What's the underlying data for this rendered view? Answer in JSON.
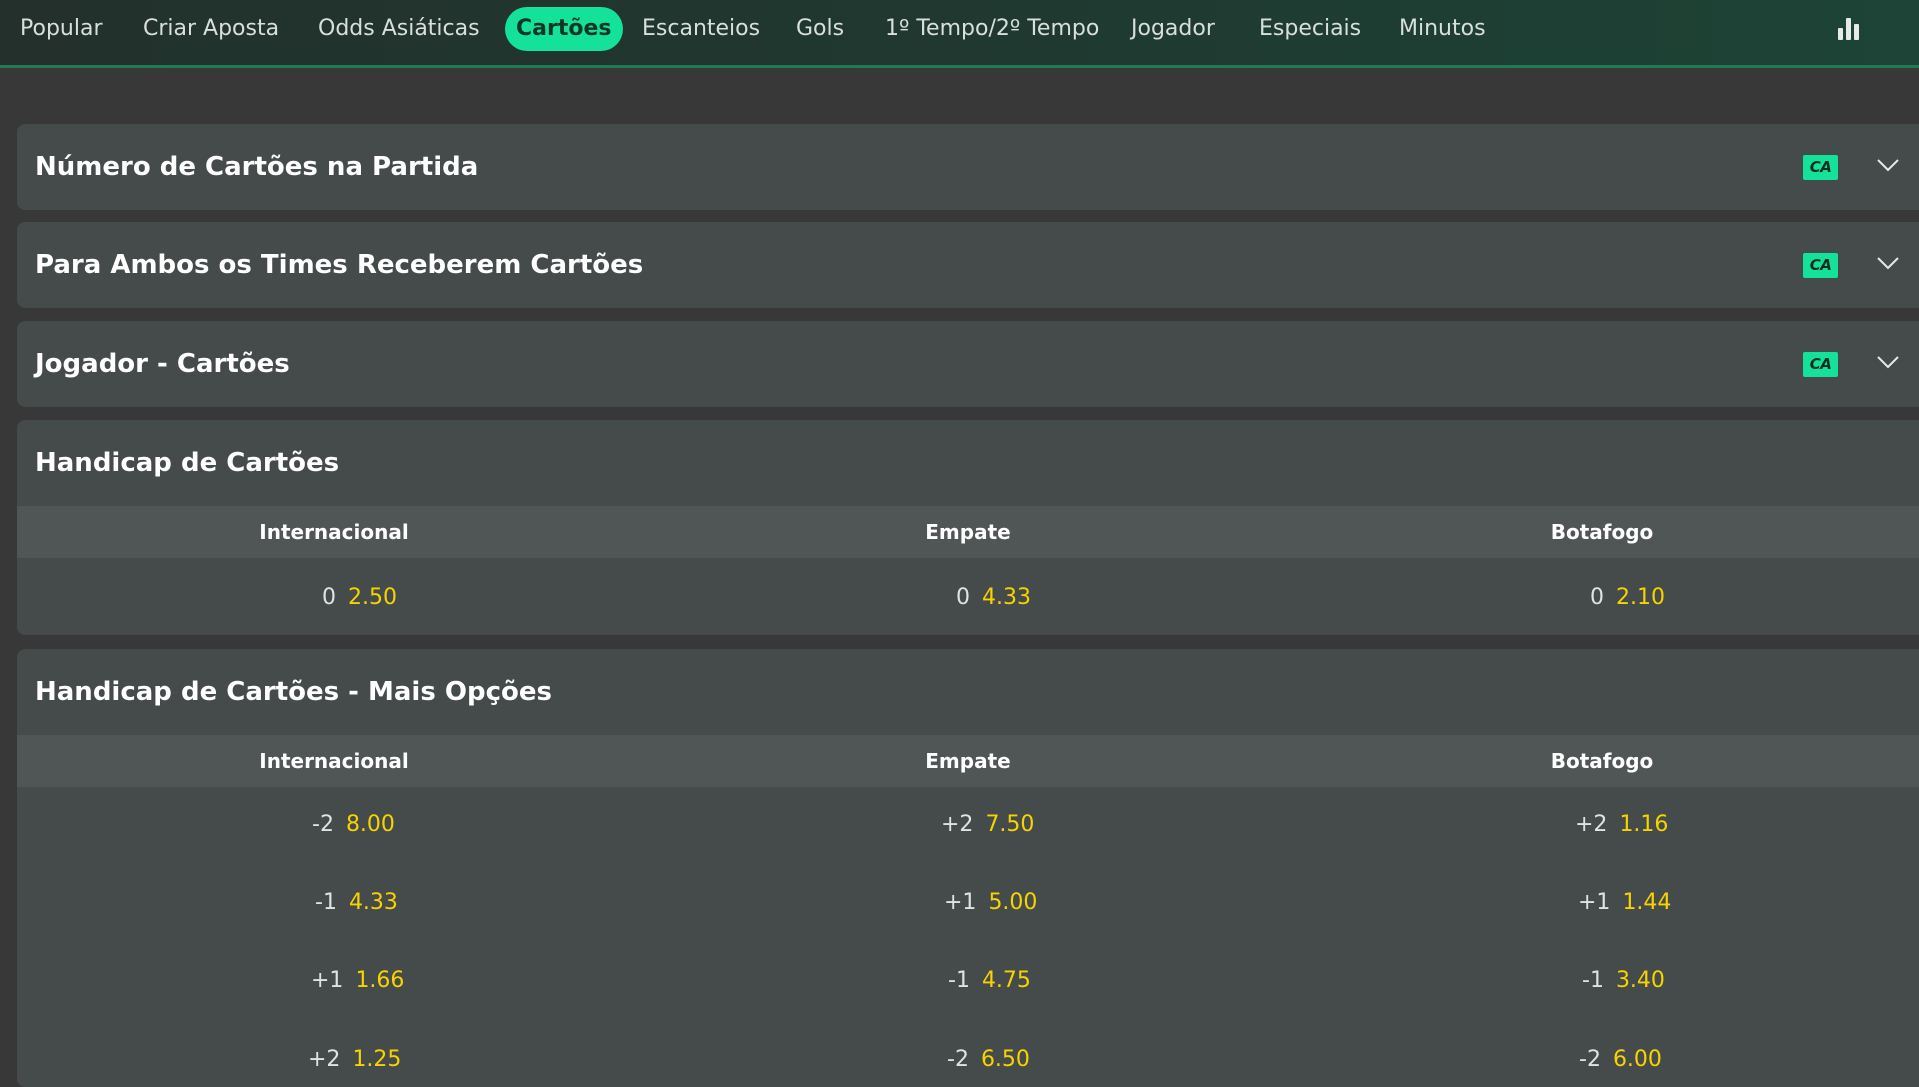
{
  "nav": {
    "tabs": [
      {
        "label": "Popular"
      },
      {
        "label": "Criar Aposta"
      },
      {
        "label": "Odds Asiáticas"
      },
      {
        "label": "Cartões"
      },
      {
        "label": "Escanteios"
      },
      {
        "label": "Gols"
      },
      {
        "label": "1º Tempo/2º Tempo"
      },
      {
        "label": "Jogador"
      },
      {
        "label": "Especiais"
      },
      {
        "label": "Minutos"
      }
    ],
    "active_tab": "Cartões",
    "stats_icon": "bar-chart-icon"
  },
  "markets": {
    "collapsed": [
      {
        "title": "Número de Cartões na Partida",
        "badge": "CA"
      },
      {
        "title": "Para Ambos os Times Receberem Cartões",
        "badge": "CA"
      },
      {
        "title": "Jogador - Cartões",
        "badge": "CA"
      }
    ],
    "handicap": {
      "title": "Handicap de Cartões",
      "columns": [
        "Internacional",
        "Empate",
        "Botafogo"
      ],
      "rows": [
        [
          {
            "line": "0",
            "price": "2.50"
          },
          {
            "line": "0",
            "price": "4.33"
          },
          {
            "line": "0",
            "price": "2.10"
          }
        ]
      ]
    },
    "handicap_more": {
      "title": "Handicap de Cartões - Mais Opções",
      "columns": [
        "Internacional",
        "Empate",
        "Botafogo"
      ],
      "rows": [
        [
          {
            "line": "-2",
            "price": "8.00"
          },
          {
            "line": "+2",
            "price": "7.50"
          },
          {
            "line": "+2",
            "price": "1.16"
          }
        ],
        [
          {
            "line": "-1",
            "price": "4.33"
          },
          {
            "line": "+1",
            "price": "5.00"
          },
          {
            "line": "+1",
            "price": "1.44"
          }
        ],
        [
          {
            "line": "+1",
            "price": "1.66"
          },
          {
            "line": "-1",
            "price": "4.75"
          },
          {
            "line": "-1",
            "price": "3.40"
          }
        ],
        [
          {
            "line": "+2",
            "price": "1.25"
          },
          {
            "line": "-2",
            "price": "6.50"
          },
          {
            "line": "-2",
            "price": "6.00"
          }
        ]
      ]
    }
  },
  "colors": {
    "accent": "#14e29b",
    "odds": "#f7d300",
    "card_bg": "#454a4a",
    "page_bg": "#383838"
  }
}
